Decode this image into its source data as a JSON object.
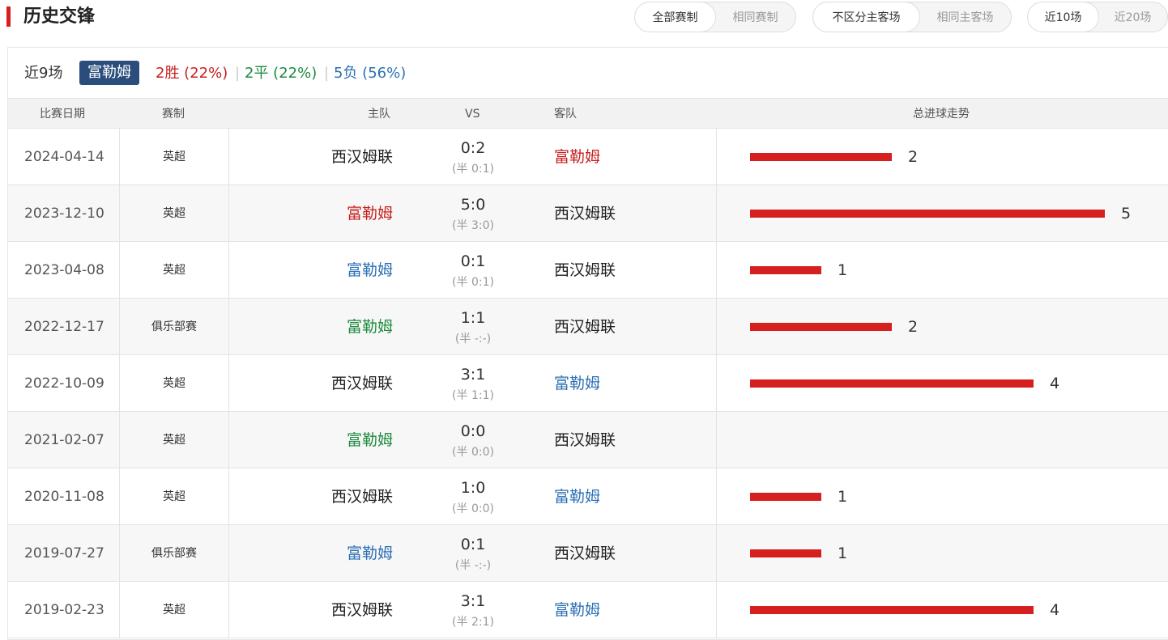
{
  "header": {
    "title": "历史交锋",
    "filters": [
      {
        "options": [
          "全部赛制",
          "相同赛制"
        ],
        "active": 0
      },
      {
        "options": [
          "不区分主客场",
          "相同主客场"
        ],
        "active": 0
      },
      {
        "options": [
          "近10场",
          "近20场"
        ],
        "active": 0
      }
    ]
  },
  "summary": {
    "recent": "近9场",
    "team": "富勒姆",
    "wins": "2胜 (22%)",
    "draws": "2平 (22%)",
    "losses": "5负 (56%)",
    "sep": "|"
  },
  "columns": {
    "date": "比赛日期",
    "competition": "赛制",
    "home": "主队",
    "vs": "VS",
    "away": "客队",
    "trend": "总进球走势"
  },
  "colors": {
    "win": "#c7201f",
    "draw": "#1c8a3f",
    "loss": "#2b6fb5",
    "bar": "#d61f1f",
    "tag": "#2a4d7c"
  },
  "matches": [
    {
      "date": "2024-04-14",
      "comp": "英超",
      "home": "西汉姆联",
      "away": "富勒姆",
      "score": "0:2",
      "half": "(半 0:1)",
      "total": 2,
      "total_label": "2",
      "fulham_side": "away",
      "result": "win"
    },
    {
      "date": "2023-12-10",
      "comp": "英超",
      "home": "富勒姆",
      "away": "西汉姆联",
      "score": "5:0",
      "half": "(半 3:0)",
      "total": 5,
      "total_label": "5",
      "fulham_side": "home",
      "result": "win"
    },
    {
      "date": "2023-04-08",
      "comp": "英超",
      "home": "富勒姆",
      "away": "西汉姆联",
      "score": "0:1",
      "half": "(半 0:1)",
      "total": 1,
      "total_label": "1",
      "fulham_side": "home",
      "result": "loss"
    },
    {
      "date": "2022-12-17",
      "comp": "俱乐部赛",
      "home": "富勒姆",
      "away": "西汉姆联",
      "score": "1:1",
      "half": "(半 -:-)",
      "total": 2,
      "total_label": "2",
      "fulham_side": "home",
      "result": "draw"
    },
    {
      "date": "2022-10-09",
      "comp": "英超",
      "home": "西汉姆联",
      "away": "富勒姆",
      "score": "3:1",
      "half": "(半 1:1)",
      "total": 4,
      "total_label": "4",
      "fulham_side": "away",
      "result": "loss"
    },
    {
      "date": "2021-02-07",
      "comp": "英超",
      "home": "富勒姆",
      "away": "西汉姆联",
      "score": "0:0",
      "half": "(半 0:0)",
      "total": 0,
      "total_label": "",
      "fulham_side": "home",
      "result": "draw"
    },
    {
      "date": "2020-11-08",
      "comp": "英超",
      "home": "西汉姆联",
      "away": "富勒姆",
      "score": "1:0",
      "half": "(半 0:0)",
      "total": 1,
      "total_label": "1",
      "fulham_side": "away",
      "result": "loss"
    },
    {
      "date": "2019-07-27",
      "comp": "俱乐部赛",
      "home": "富勒姆",
      "away": "西汉姆联",
      "score": "0:1",
      "half": "(半 -:-)",
      "total": 1,
      "total_label": "1",
      "fulham_side": "home",
      "result": "loss"
    },
    {
      "date": "2019-02-23",
      "comp": "英超",
      "home": "西汉姆联",
      "away": "富勒姆",
      "score": "3:1",
      "half": "(半 2:1)",
      "total": 4,
      "total_label": "4",
      "fulham_side": "away",
      "result": "loss"
    }
  ]
}
